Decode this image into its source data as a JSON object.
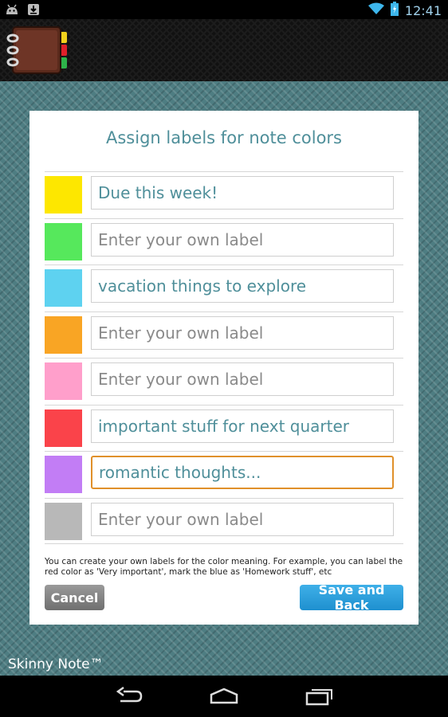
{
  "status_bar": {
    "time": "12:41",
    "left_icons": [
      "android-icon",
      "download-icon"
    ],
    "right_icons": [
      "wifi-icon",
      "battery-icon"
    ]
  },
  "app": {
    "logo": "notebook-icon",
    "brand": "Skinny Note™"
  },
  "dialog": {
    "title": "Assign labels for note colors",
    "labels": [
      {
        "color": "#fde700",
        "value": "Due this week!",
        "placeholder": "Enter your own label"
      },
      {
        "color": "#56e85c",
        "value": "",
        "placeholder": "Enter your own label"
      },
      {
        "color": "#5ed2f0",
        "value": "vacation things to explore",
        "placeholder": "Enter your own label"
      },
      {
        "color": "#f9a524",
        "value": "",
        "placeholder": "Enter your own label"
      },
      {
        "color": "#ff9fcb",
        "value": "",
        "placeholder": "Enter your own label"
      },
      {
        "color": "#fa434a",
        "value": "important stuff for next quarter",
        "placeholder": "Enter your own label"
      },
      {
        "color": "#c27df5",
        "value": "romantic thoughts...",
        "placeholder": "Enter your own label"
      },
      {
        "color": "#b8b8b8",
        "value": "",
        "placeholder": "Enter your own label"
      }
    ],
    "help_text": "You can create your own labels for the color meaning. For example, you can label the red color as 'Very important', mark the blue as 'Homework stuff', etc",
    "cancel_label": "Cancel",
    "save_label": "Save and Back"
  },
  "nav_bar": {
    "icons": [
      "back-icon",
      "home-icon",
      "recent-apps-icon"
    ]
  }
}
